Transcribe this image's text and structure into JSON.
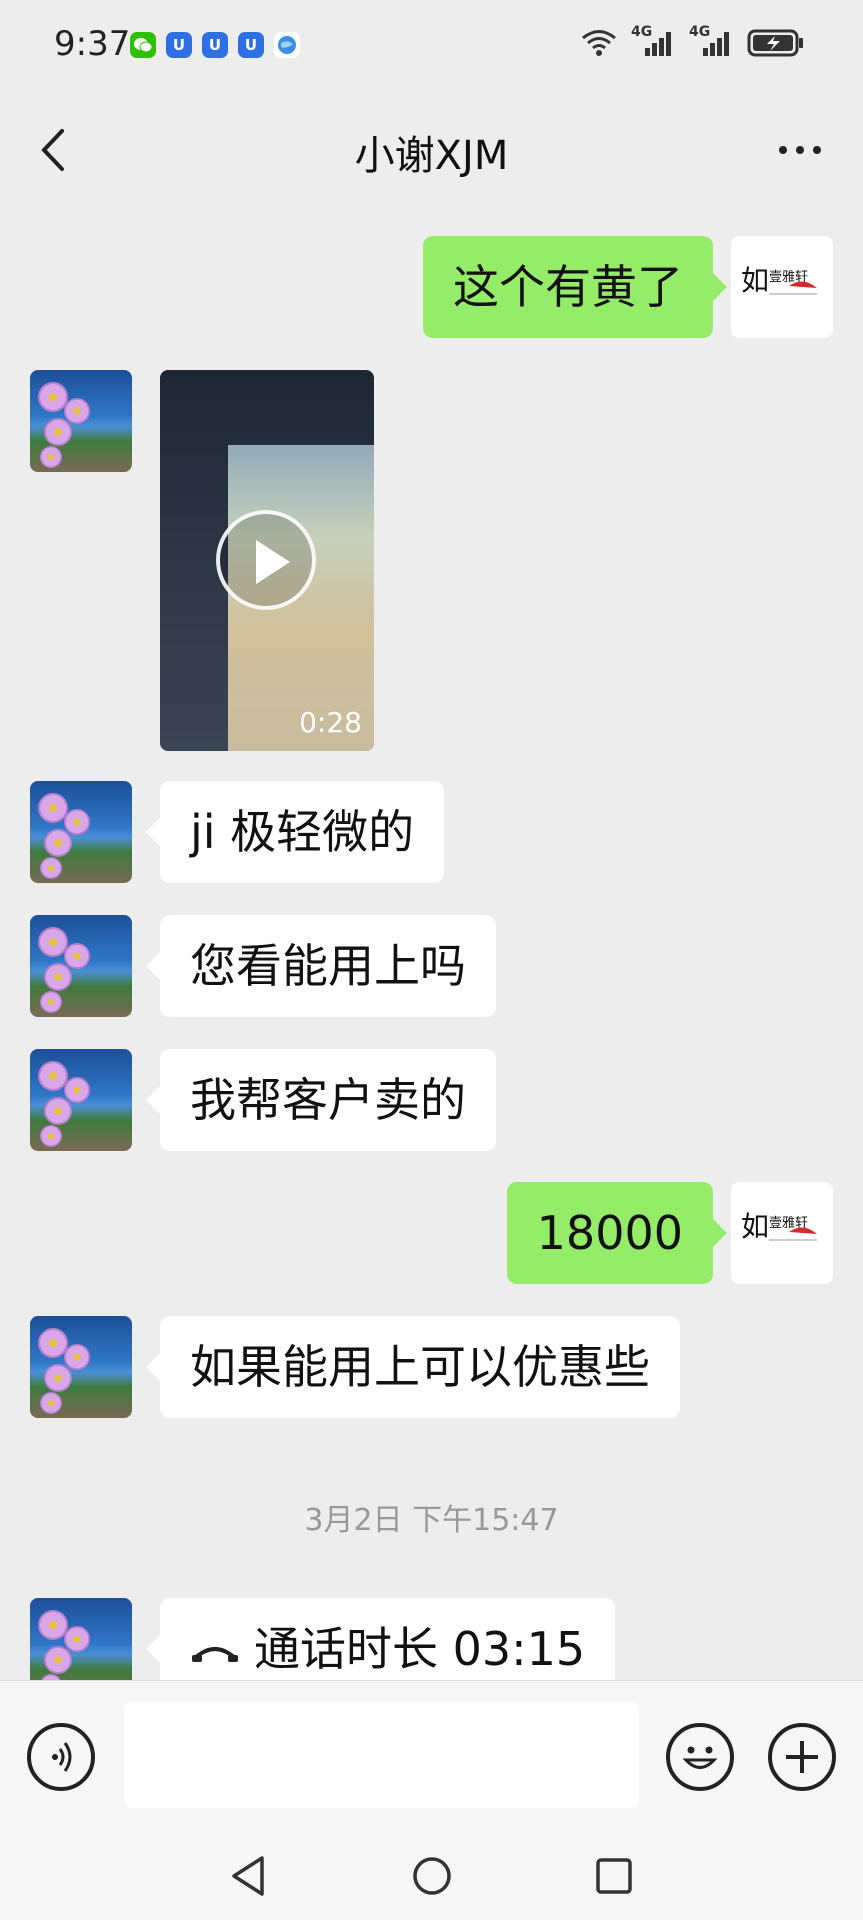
{
  "status_bar": {
    "time": "9:37",
    "left_icons": [
      "wechat-icon",
      "shield-app-icon",
      "shield-app-icon",
      "shield-app-icon",
      "globe-app-icon"
    ],
    "right_icons": [
      "wifi-icon",
      "signal-4g-icon",
      "signal-4g-icon",
      "battery-charging-icon"
    ],
    "network_label_1": "4G",
    "network_label_2": "4G"
  },
  "header": {
    "title": "小谢XJM",
    "back_icon": "chevron-left-icon",
    "more_icon": "more-dots-icon"
  },
  "messages": [
    {
      "side": "out",
      "type": "text",
      "text": "这个有黄了"
    },
    {
      "side": "in",
      "type": "video",
      "duration": "0:28"
    },
    {
      "side": "in",
      "type": "text",
      "text": "ji 极轻微的"
    },
    {
      "side": "in",
      "type": "text",
      "text": "您看能用上吗"
    },
    {
      "side": "in",
      "type": "text",
      "text": "我帮客户卖的"
    },
    {
      "side": "out",
      "type": "text",
      "text": "18000"
    },
    {
      "side": "in",
      "type": "text",
      "text": "如果能用上可以优惠些"
    },
    {
      "type": "timestamp",
      "text": "3月2日 下午15:47"
    },
    {
      "side": "in",
      "type": "call",
      "text": "通话时长 03:15"
    }
  ],
  "input_bar": {
    "voice_icon": "voice-icon",
    "emoji_icon": "emoji-icon",
    "plus_icon": "plus-icon",
    "input_value": ""
  },
  "nav_bar": [
    "back-triangle-icon",
    "home-circle-icon",
    "recents-square-icon"
  ],
  "colors": {
    "background": "#ededed",
    "outgoing_bubble": "#95ec69",
    "incoming_bubble": "#ffffff"
  }
}
